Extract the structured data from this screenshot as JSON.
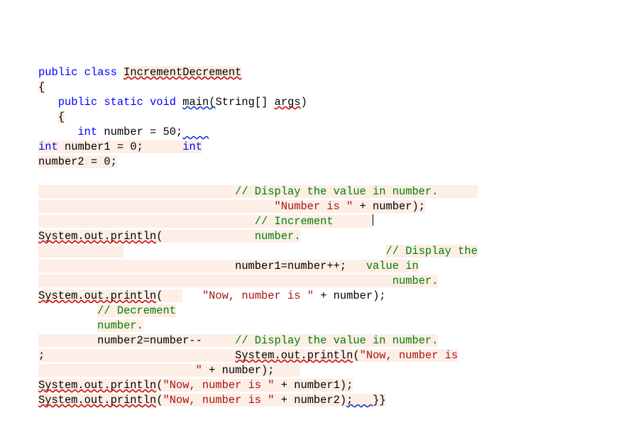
{
  "t": {
    "public": "public",
    "class_": "class",
    "IncrementDecrement": "IncrementDecrement",
    "lbrace": "{",
    "rbrace": "}",
    "static_": "static",
    "void_": "void",
    "main": "main",
    "lparen": "(",
    "rparen": ")",
    "String": "String",
    "brackets": "[]",
    "args": "args",
    "int_": "int",
    "number": "number",
    "eq50": " = 50;",
    "number1": "number1",
    "eq0a": " = 0;",
    "number2": "number2",
    "eq0b": " = 0;",
    "cDisplay1": "// Display the value in number.",
    "strNumberIs": "\"Number is \"",
    "plusNumberParen": " + number);",
    "cIncrement": "// Increment",
    "cNumberDot": "number.",
    "Sop": "System.out.println",
    "cDisplayThe": "// Display the",
    "incr": "number1=number++;",
    "cValueIn": "value in",
    "cNumberDot2": "number.",
    "strNowNumberIs": "\"Now, number is \"",
    "cDecrement": "// Decrement",
    "cNumberDot3": "number.",
    "decr": "number2=number--",
    "cDisplay2": "// Display the value in number.",
    "semi": ";",
    "sopNow": "\"Now, number is",
    "dq": "\"",
    "plusNumberParen2": " + number);",
    "plusNumber1Paren": " + number1);",
    "plusNumber2Paren": " + number2)",
    "trailSemi": ";",
    "spacesTrail": "   ",
    "rbr2": "}}"
  }
}
